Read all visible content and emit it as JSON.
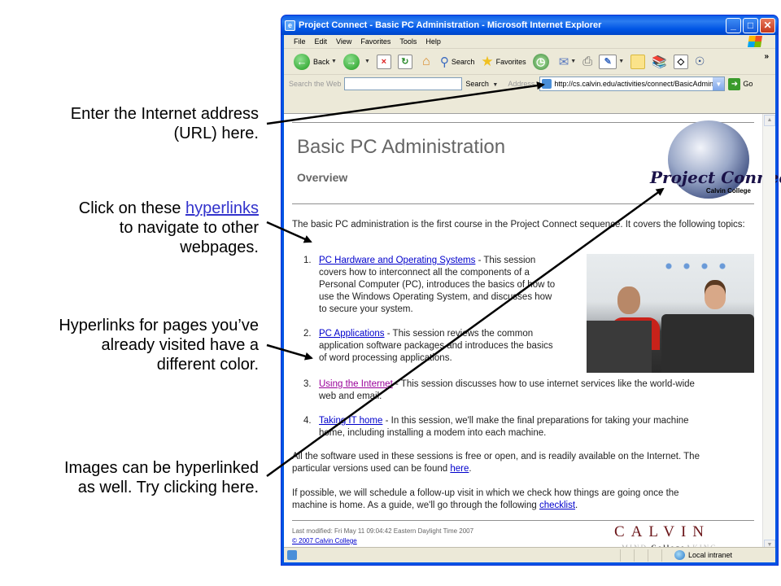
{
  "callouts": [
    {
      "lines": [
        "Enter the Internet address",
        "(URL) here."
      ]
    },
    {
      "prefix": "Click on these ",
      "link": "hyperlinks",
      "lines": [
        "to navigate to other",
        "webpages."
      ]
    },
    {
      "lines": [
        "Hyperlinks for pages you’ve",
        "already visited have a",
        "different color."
      ]
    },
    {
      "lines": [
        "Images can be hyperlinked",
        "as well.  Try clicking here."
      ]
    }
  ],
  "window": {
    "title": "Project Connect - Basic PC Administration - Microsoft Internet Explorer",
    "controls": {
      "minimize": "_",
      "maximize": "□",
      "close": "✕"
    }
  },
  "menubar": [
    "File",
    "Edit",
    "View",
    "Favorites",
    "Tools",
    "Help"
  ],
  "toolbar": {
    "back": "Back",
    "search": "Search",
    "favorites": "Favorites"
  },
  "addressbar": {
    "search_web_label": "Search the Web",
    "search_value": "",
    "search_button": "Search",
    "address_label": "Address",
    "url": "http://cs.calvin.edu/activities/connect/BasicAdmin",
    "go": "Go"
  },
  "page": {
    "title": "Basic PC Administration",
    "subtitle": "Overview",
    "logo_text": "Project Connect",
    "logo_sub": "Calvin College",
    "intro": "The basic PC administration is the first course in the Project Connect sequence. It covers the following topics:",
    "topics": [
      {
        "num": "1.",
        "link": "PC Hardware and Operating Systems",
        "visited": false,
        "lines": [
          " - This session",
          "covers how to interconnect all the components of a",
          "Personal Computer (PC), introduces the basics of how to",
          "use the Windows Operating System, and discusses how",
          "to secure your system."
        ]
      },
      {
        "num": "2.",
        "link": "PC Applications",
        "visited": false,
        "lines": [
          " - This session reviews the common",
          "application software packages and introduces the basics",
          "of word processing applications."
        ]
      },
      {
        "num": "3.",
        "link": "Using the Internet",
        "visited": true,
        "lines": [
          " - This session discusses how to use internet services like the world-wide",
          "web and email."
        ]
      },
      {
        "num": "4.",
        "link": "Taking IT home",
        "visited": false,
        "lines": [
          " - In this session, we'll make the final preparations for taking your machine",
          "home, including installing a modem into each machine."
        ]
      }
    ],
    "software_text": "All the software used in these sessions is free or open, and is readily available on the Internet. The",
    "software_text2": "particular versions used can be found ",
    "software_link": "here",
    "followup_text": "If possible, we will schedule a follow-up visit in which we check how things are going once the",
    "followup_text2": "machine is home. As a guide, we'll go through the following ",
    "followup_link": "checklist",
    "last_modified": "Last modified: Fri May 11 09:04:42 Eastern Daylight Time 2007",
    "copyright": "© 2007 Calvin College",
    "calvin": "CALVIN",
    "tagline_left": "MIND",
    "tagline_mid": "College",
    "tagline_right": "AKING"
  },
  "statusbar": {
    "zone": "Local intranet"
  },
  "colors": {
    "link": "#0000cc",
    "visited": "#990099",
    "callout_link": "#3333cc",
    "xp_blue": "#0054e3"
  }
}
